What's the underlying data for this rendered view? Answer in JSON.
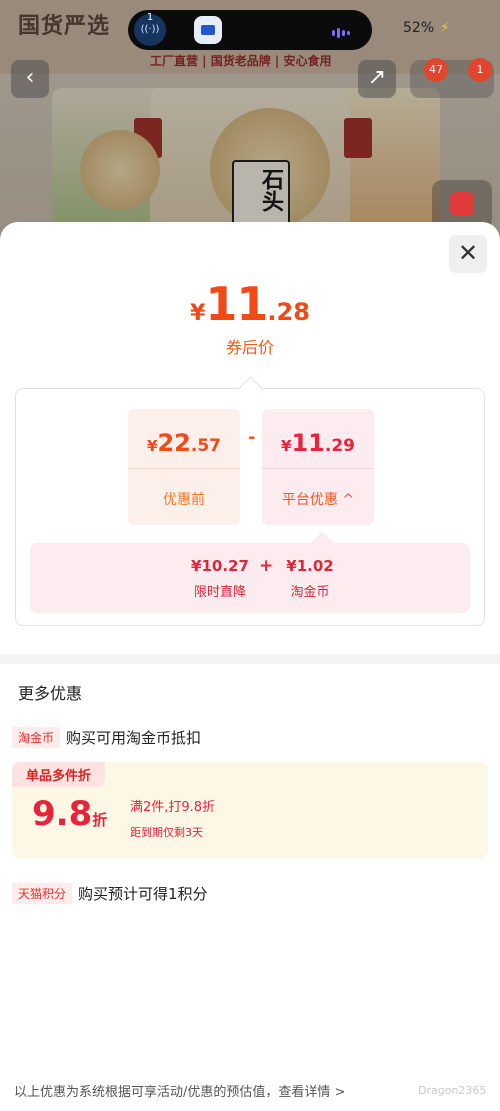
{
  "status_bar": {
    "call_count": "1",
    "battery": "52%"
  },
  "product_header": {
    "brand": "国货严选",
    "slogan": "工厂直营 | 国货老品牌 | 安心食用",
    "package_text": "石头",
    "cart_badge_a": "47",
    "cart_badge_b": "1"
  },
  "sheet": {
    "final_price": {
      "currency": "¥",
      "integer": "11",
      "decimal": ".28",
      "label": "券后价"
    },
    "breakdown": {
      "before": {
        "currency": "¥",
        "integer": "22",
        "decimal": ".57",
        "label": "优惠前"
      },
      "operator": "-",
      "discount": {
        "currency": "¥",
        "integer": "11",
        "decimal": ".29",
        "label": "平台优惠 ^"
      },
      "detail": {
        "item_a_value": "¥10.27",
        "item_a_label": "限时直降",
        "plus": "+",
        "item_b_value": "¥1.02",
        "item_b_label": "淘金币"
      }
    },
    "more": {
      "title": "更多优惠",
      "taojinbi_tag": "淘金币",
      "taojinbi_text": "购买可用淘金币抵扣",
      "multi_tag": "单品多件折",
      "multi_value": "9.8",
      "multi_unit": "折",
      "multi_desc": "满2件,打9.8折",
      "multi_sub": "距到期仅剩3天",
      "tmall_tag": "天猫积分",
      "tmall_text": "购买预计可得1积分"
    },
    "footer_note": "以上优惠为系统根据可享活动/优惠的预估值，查看详情 >",
    "watermark": "Dragon2365"
  },
  "colors": {
    "price_orange": "#f04a18",
    "price_red": "#e8243c",
    "tag_bg": "#fdecec",
    "multi_bg": "#fdf7e6"
  }
}
